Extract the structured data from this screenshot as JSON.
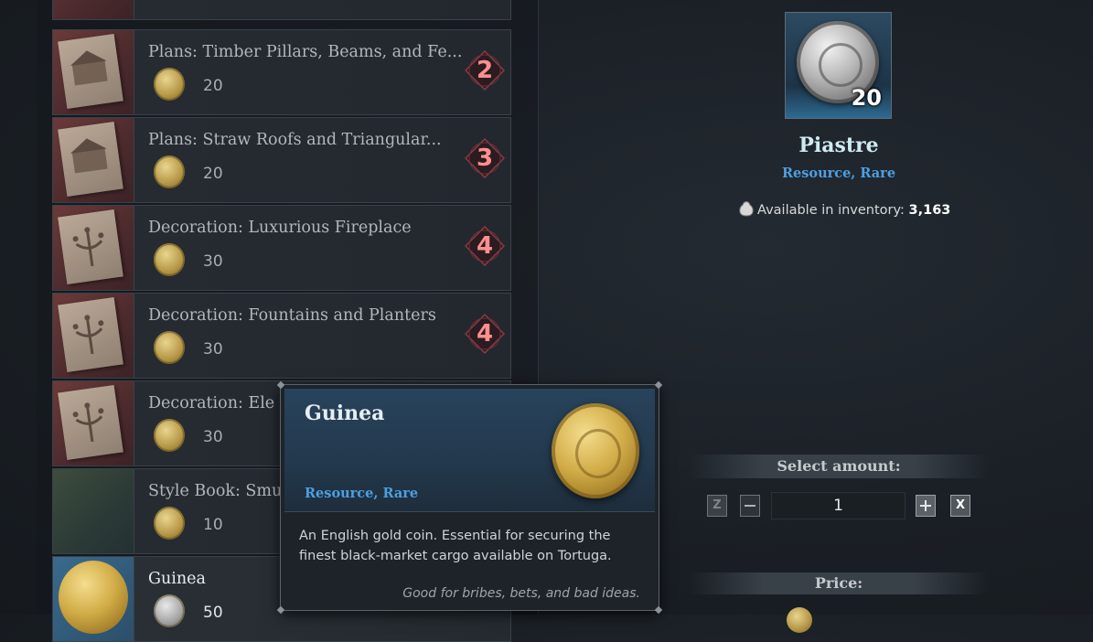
{
  "list": {
    "rows": [
      {
        "title": "Plans: Timber Pillars, Beams, and Fe...",
        "price": "20",
        "badge": "2",
        "coin": "gold"
      },
      {
        "title": "Plans: Straw Roofs and Triangular...",
        "price": "20",
        "badge": "3",
        "coin": "gold"
      },
      {
        "title": "Decoration: Luxurious Fireplace",
        "price": "30",
        "badge": "4",
        "coin": "gold"
      },
      {
        "title": "Decoration: Fountains and Planters",
        "price": "30",
        "badge": "4",
        "coin": "gold"
      },
      {
        "title": "Decoration: Ele",
        "price": "30",
        "badge": "",
        "coin": "gold"
      },
      {
        "title": "Style Book: Smu",
        "price": "10",
        "badge": "",
        "coin": "gold"
      },
      {
        "title": "Guinea",
        "price": "50",
        "badge": "",
        "coin": "silver"
      }
    ]
  },
  "detail": {
    "quantity": "20",
    "name": "Piastre",
    "tags": "Resource, Rare",
    "inventory_label": "Available in inventory:",
    "inventory_value": "3,163",
    "select_amount_label": "Select amount:",
    "amount_value": "1",
    "z_key": "Z",
    "x_key": "X",
    "price_label": "Price:"
  },
  "tooltip": {
    "title": "Guinea",
    "tags": "Resource, Rare",
    "description": "An English gold coin. Essential for securing the finest black-market cargo available on Tortuga.",
    "flavor": "Good for bribes, bets, and bad ideas."
  },
  "colors": {
    "rare_blue": "#4e9fe0",
    "badge_red": "#ff8f8f",
    "panel_dark": "#1a1f25"
  }
}
